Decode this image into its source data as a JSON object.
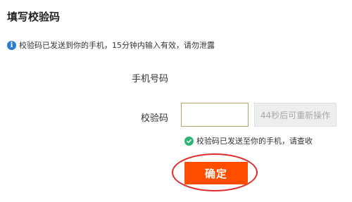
{
  "header": {
    "title": "填写校验码"
  },
  "notice": {
    "icon": "info-icon",
    "text": "校验码已发送到你的手机，15分钟内输入有效，请勿泄露"
  },
  "form": {
    "phone_label": "手机号码",
    "phone_value": "",
    "code_label": "校验码",
    "code_value": "",
    "resend_label": "44秒后可重新操作",
    "sent_tip": "校验码已发送至你的手机，请查收",
    "confirm_label": "确定"
  },
  "colors": {
    "accent": "#ff4d00",
    "info": "#2a7ad6",
    "success": "#2bb673",
    "highlight_ring": "#e02a2a"
  }
}
